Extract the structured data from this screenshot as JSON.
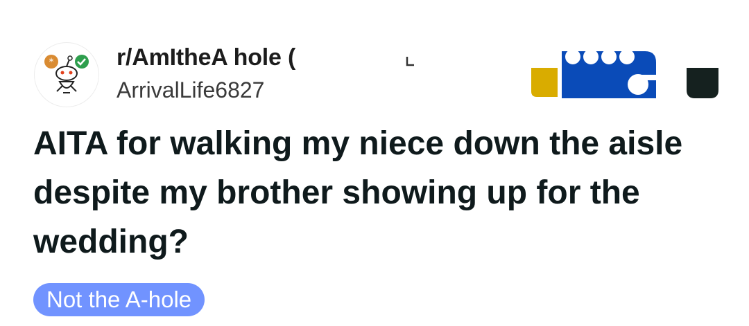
{
  "post_header": {
    "subreddit": "r/AmItheA  hole (",
    "username": "ArrivalLife6827",
    "avatar_icon": "snoo-mascot-icon"
  },
  "post": {
    "title": "AITA for walking my niece down the aisle despite my brother showing up for the wedding?",
    "flair": "Not the A-hole"
  },
  "colors": {
    "flair_bg": "#7193ff",
    "award_blue": "#0a4bb8",
    "award_gold": "#d9ac00",
    "award_dark": "#15211f"
  }
}
